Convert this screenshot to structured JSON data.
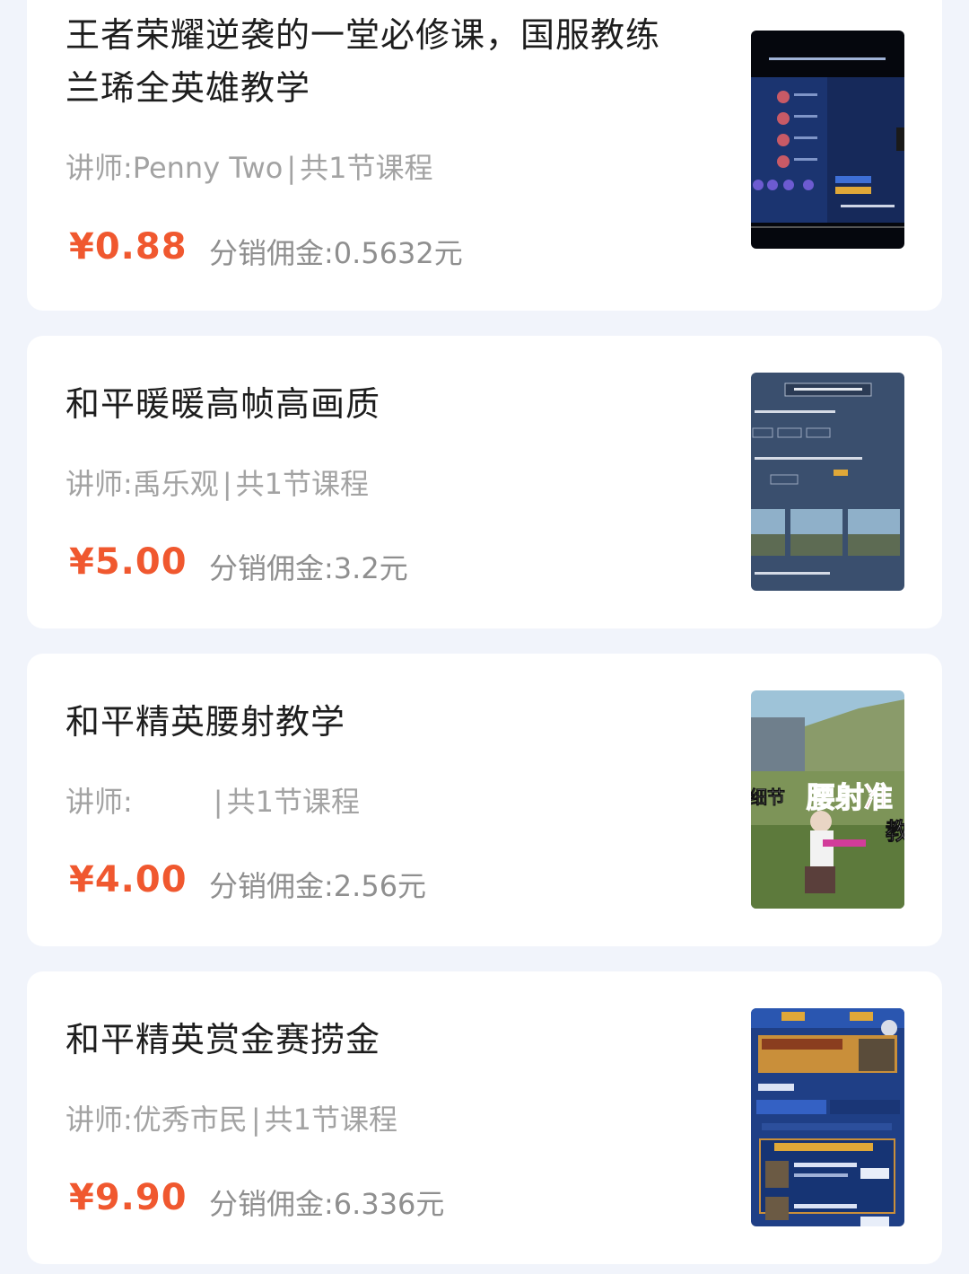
{
  "courses": [
    {
      "title": "王者荣耀逆袭的一堂必修课，国服教练兰琋全英雄教学",
      "teacher_prefix": "讲师:",
      "teacher": "Penny Two",
      "separator": "|",
      "lessons": "共1节课程",
      "price": "¥0.88",
      "commission_label": "分销佣金:",
      "commission": "0.5632元",
      "thumbnail": "video-player-hero-list"
    },
    {
      "title": "和平暖暖高帧高画质",
      "teacher_prefix": "讲师:",
      "teacher": "禹乐观",
      "separator": "|",
      "lessons": "共1节课程",
      "price": "¥5.00",
      "commission_label": "分销佣金:",
      "commission": "3.2元",
      "thumbnail": "graphics-settings-screenshot"
    },
    {
      "title": "和平精英腰射教学",
      "teacher_prefix": "讲师:",
      "teacher": "",
      "separator": "|",
      "lessons": "共1节课程",
      "price": "¥4.00",
      "commission_label": "分销佣金:",
      "commission": "2.56元",
      "thumbnail": "hip-fire-gameplay-screenshot",
      "thumbnail_text_a": "细节",
      "thumbnail_text_b": "腰射准",
      "thumbnail_text_c": "教"
    },
    {
      "title": "和平精英赏金赛捞金",
      "teacher_prefix": "讲师:",
      "teacher": "优秀市民",
      "separator": "|",
      "lessons": "共1节课程",
      "price": "¥9.90",
      "commission_label": "分销佣金:",
      "commission": "6.336元",
      "thumbnail": "bounty-match-lobby-screenshot"
    }
  ],
  "colors": {
    "page_bg": "#f1f4fb",
    "card_bg": "#ffffff",
    "title": "#1d1d1d",
    "meta": "#a3a3a3",
    "price": "#f0582f",
    "commission": "#8f8f8f"
  }
}
